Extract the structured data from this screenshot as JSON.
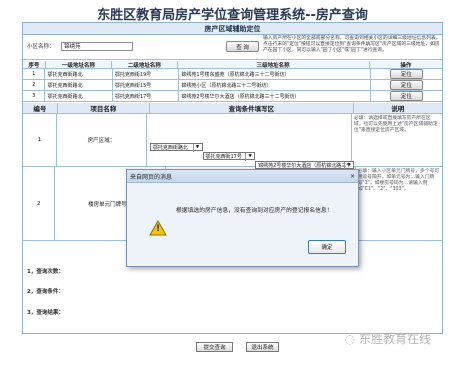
{
  "page": {
    "title": "东胜区教育局房产学位查询管理系统--房产查询",
    "footer_note": "1，查询次数：",
    "query_conditions": "2，查询条件：",
    "query_result": "3，查询结果："
  },
  "section": {
    "location_title": "房产区域辅助定位",
    "conditions_title": "查询条件填写区",
    "description_title": "说明"
  },
  "search": {
    "label": "小区名称：",
    "value": "锦绣苑",
    "button": "查 询",
    "help": "输入房产所在小区的全部或部分名称，可查询到相关小区的详细三级地址信息列表，点击行末的\"定位\"按钮可以直接定位到\"查询条件填写区\"房产区域的三级地址，如房产在园丁小区，同可以输入\"园丁小区\"或\"园丁\"进行查询。"
  },
  "address_table": {
    "headers": [
      "序号",
      "一级地址名称",
      "二级地址名称",
      "三级地址名称",
      "操作"
    ],
    "rows": [
      {
        "no": "1",
        "first": "鄂托克西街路北",
        "second": "鄂托克西街19号",
        "third": "锦绣苑1号楼东盛苑（原杭锦北路三十二号街坊）",
        "action": "定位"
      },
      {
        "no": "2",
        "first": "鄂托克西街路北",
        "second": "鄂托克西街15号",
        "third": "锦绣苑小区（原杭锦北路三十二号街坊）",
        "action": "定位"
      },
      {
        "no": "3",
        "first": "鄂托克西街路北",
        "second": "鄂托克西街17号",
        "third": "锦绣苑2号楼华尔大酒店（原杭锦北路三十二号街坊）",
        "action": "定位"
      }
    ]
  },
  "condition_table": {
    "headers": [
      "编号",
      "项目名称",
      "查询条件填写区",
      "说明"
    ],
    "rows": [
      {
        "no": "1",
        "name": "房产区域：",
        "select_1": "鄂托克西街路北",
        "select_2": "鄂托克西街17号",
        "select_3": "锦绣苑2号楼华尔大酒店（原杭锦北路三十二号街坊）",
        "note": "必填：请选择或直接填写房产所在区域，也可以先使用上述\"房产区域辅助定位\"来直接定位房产区域。"
      },
      {
        "no": "2",
        "name": "楼房单元门牌号：",
        "note": "必填：输入小区单元门牌号，多个号可用逗号隔开。如单元号为…输入门牌号\"1\"，如楼房号码为…请输入例如\"C1\"、\"2\"、\"303\"。"
      }
    ]
  },
  "dialog": {
    "title": "来自网页的消息",
    "message": "根据填选的房产信息，没有查询到对应房产的登记报名信息！",
    "ok": "确定",
    "close": "×"
  },
  "footer": {
    "submit": "提交查询",
    "exit": "退出系统"
  },
  "watermark": {
    "text": "东胜教育在线"
  },
  "colors": {
    "header_bg": "#dfeaf6",
    "border": "#8fb2d8",
    "dialog_bg": "#eef3fa",
    "warning": "#f2c500"
  }
}
